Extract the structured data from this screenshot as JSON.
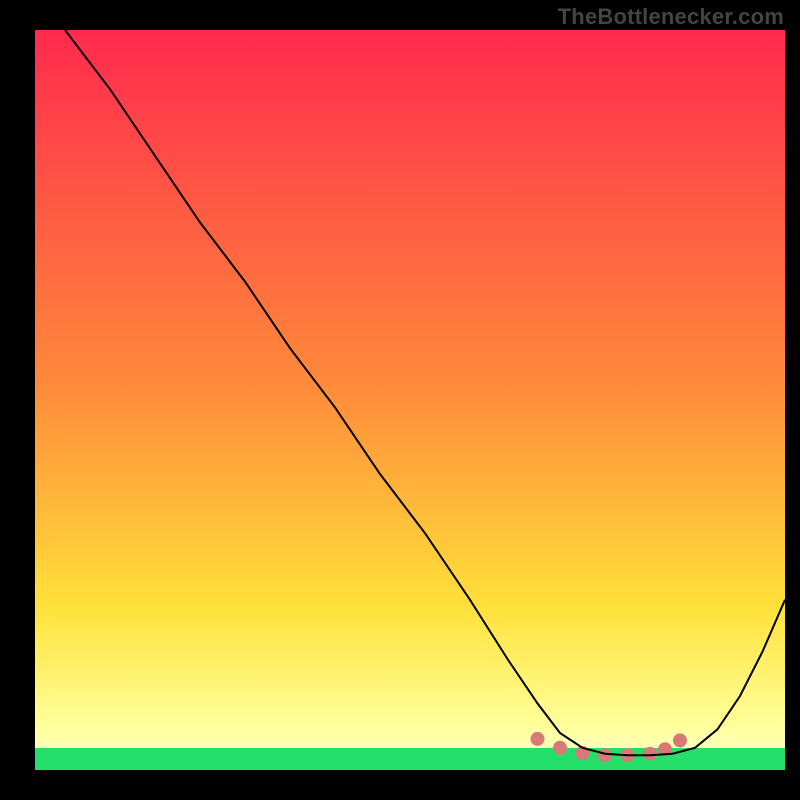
{
  "watermark": "TheBottlenecker.com",
  "chart_data": {
    "type": "line",
    "title": "",
    "xlabel": "",
    "ylabel": "",
    "xlim": [
      0,
      100
    ],
    "ylim": [
      0,
      100
    ],
    "background_gradient": {
      "top_color": "#ff2a4d",
      "mid_color": "#ffd43a",
      "low_color": "#ffff9a",
      "bottom_band_color": "#24e06a",
      "bottom_band_frac": 0.03
    },
    "series": [
      {
        "name": "curve",
        "stroke": "#000000",
        "stroke_width": 2,
        "x": [
          4,
          10,
          16,
          22,
          28,
          34,
          40,
          46,
          52,
          58,
          63,
          67,
          70,
          73,
          76,
          79,
          82,
          85,
          88,
          91,
          94,
          97,
          100
        ],
        "y": [
          100,
          92,
          83,
          74,
          66,
          57,
          49,
          40,
          32,
          23,
          15,
          9,
          5,
          3,
          2.2,
          2,
          2,
          2.2,
          3,
          5.5,
          10,
          16,
          23
        ]
      }
    ],
    "marker_cluster": {
      "color": "#d77a77",
      "radius": 7,
      "points": [
        {
          "x": 67,
          "y": 4.2
        },
        {
          "x": 70,
          "y": 3.0
        },
        {
          "x": 73,
          "y": 2.3
        },
        {
          "x": 76,
          "y": 2.0
        },
        {
          "x": 79,
          "y": 2.0
        },
        {
          "x": 82,
          "y": 2.2
        },
        {
          "x": 84,
          "y": 2.8
        },
        {
          "x": 86,
          "y": 4.0
        }
      ]
    }
  }
}
